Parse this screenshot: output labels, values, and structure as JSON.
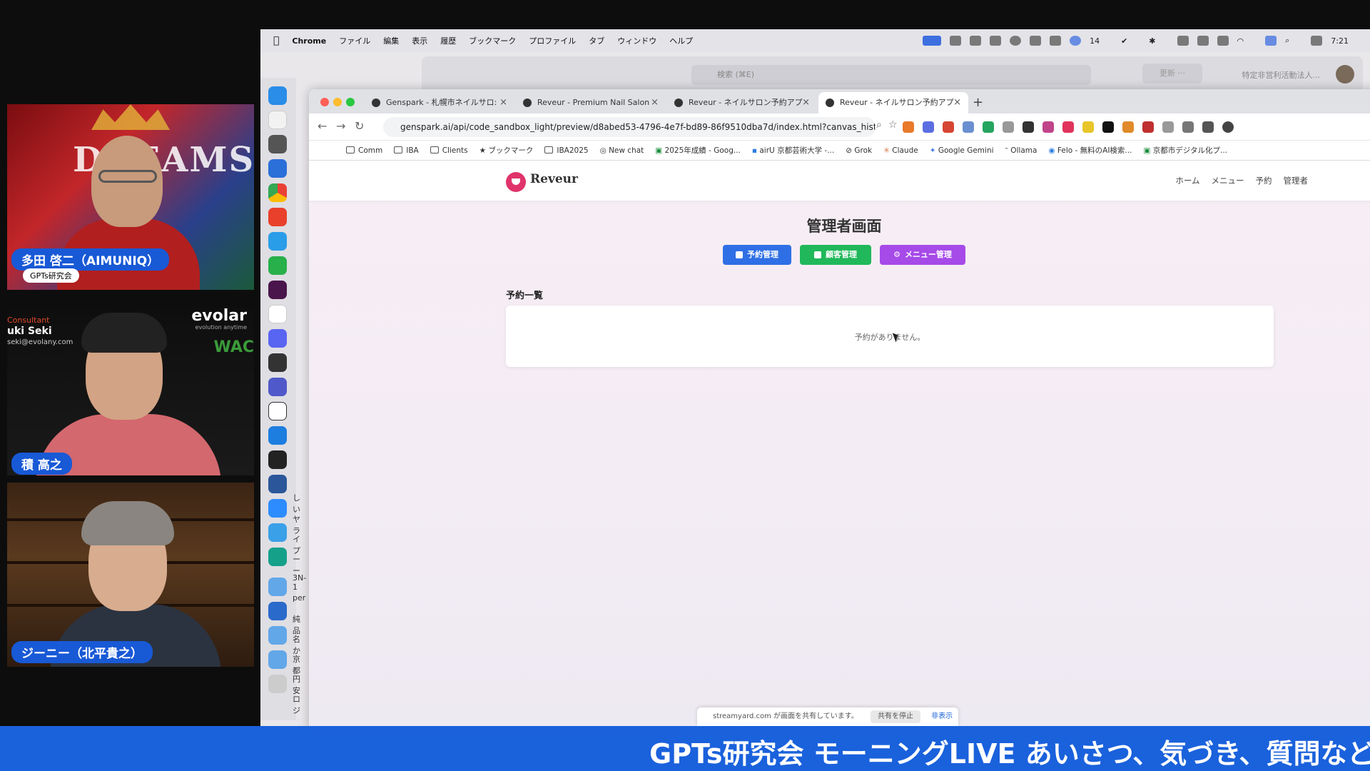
{
  "participants": [
    {
      "name": "多田 啓二（AIMUNIQ）",
      "badge": "GPTs研究会",
      "backdrop_text": "DREAMS"
    },
    {
      "name": "積 高之",
      "brand": "evolar",
      "brand_sub": "evolution anytime",
      "brand2": "WAC",
      "consult_role": "Consultant",
      "consult_name": "uki Seki",
      "consult_mail": "seki@evolany.com"
    },
    {
      "name": "ジーニー（北平貴之）"
    }
  ],
  "menubar": {
    "app": "Chrome",
    "items": [
      "ファイル",
      "編集",
      "表示",
      "履歴",
      "ブックマーク",
      "プロファイル",
      "タブ",
      "ウィンドウ",
      "ヘルプ"
    ],
    "badge_count": "14",
    "time": "7:21"
  },
  "bg_window": {
    "search_placeholder": "検索 (⌘E)",
    "update": "更新 ···",
    "right_text": "特定非営利活動法人..."
  },
  "dock_labels": [
    "しい",
    "ヤラ",
    "イプ",
    "ーー",
    "3N-1",
    "per",
    "純品",
    "名か",
    "京都",
    "円安",
    "ロジ"
  ],
  "browser": {
    "tabs": [
      {
        "label": "Genspark - 札幌市ネイルサロ:",
        "active": false
      },
      {
        "label": "Reveur - Premium Nail Salon",
        "active": false
      },
      {
        "label": "Reveur - ネイルサロン予約アプ",
        "active": false
      },
      {
        "label": "Reveur - ネイルサロン予約アプ",
        "active": true
      }
    ],
    "url": "genspark.ai/api/code_sandbox_light/preview/d8abed53-4796-4e7f-bd89-86f9510dba7d/index.html?canvas_history_...",
    "bookmarks": [
      "Comm",
      "IBA",
      "Clients",
      "ブックマーク",
      "IBA2025",
      "New chat",
      "2025年成績 - Goog...",
      "airU 京都芸術大学 -...",
      "Grok",
      "Claude",
      "Google Gemini",
      "Ollama",
      "Felo - 無料のAI検索...",
      "京都市デジタル化プ..."
    ]
  },
  "site": {
    "logo": "Reveur",
    "nav": [
      "ホーム",
      "メニュー",
      "予約",
      "管理者"
    ],
    "title": "管理者画面",
    "buttons": {
      "reservations": "予約管理",
      "customers": "顧客管理",
      "menu": "メニュー管理"
    },
    "section_title": "予約一覧",
    "empty_message": "予約がありません。"
  },
  "share_bar": {
    "text": "streamyard.com が画面を共有しています。",
    "stop": "共有を停止",
    "hide": "非表示"
  },
  "ticker": "GPTs研究会 モーニングLIVE あいさつ、気づき、質問など",
  "colors": {
    "ticker": "#1a61dc",
    "badge": "#1859d6",
    "btn_blue": "#2f6fe6",
    "btn_green": "#20b85a",
    "btn_purple": "#a64ae8",
    "logo": "#e0336b"
  }
}
